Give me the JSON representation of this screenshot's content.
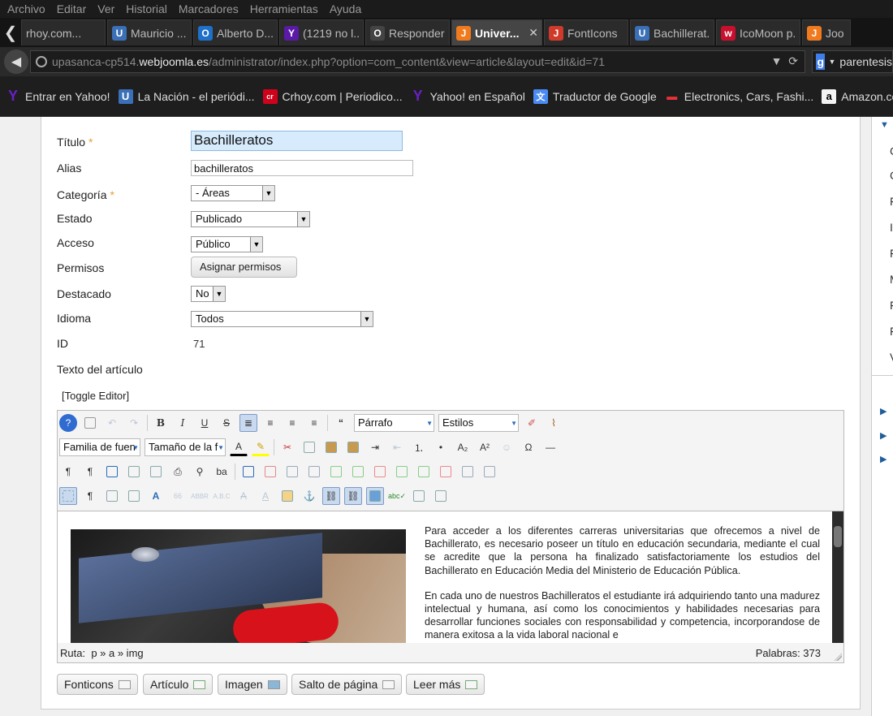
{
  "menu": [
    "Archivo",
    "Editar",
    "Ver",
    "Historial",
    "Marcadores",
    "Herramientas",
    "Ayuda"
  ],
  "tabs": [
    {
      "label": "rhoy.com...",
      "icon": "",
      "color": ""
    },
    {
      "label": "Mauricio ...",
      "icon": "U",
      "color": "#3b6fb6"
    },
    {
      "label": "Alberto D...",
      "icon": "O",
      "color": "#1e70c9"
    },
    {
      "label": "(1219 no l...",
      "icon": "Y",
      "color": "#5a1aa6"
    },
    {
      "label": "Responder...",
      "icon": "O",
      "color": "#444444"
    },
    {
      "label": "Univer...",
      "icon": "J",
      "color": "#f07a1e"
    },
    {
      "label": "FontIcons",
      "icon": "J",
      "color": "#d03a2a"
    },
    {
      "label": "Bachillerat...",
      "icon": "U",
      "color": "#3b6fb6"
    },
    {
      "label": "IcoMoon p...",
      "icon": "w",
      "color": "#c8102e"
    },
    {
      "label": "Joo",
      "icon": "J",
      "color": "#f07a1e"
    }
  ],
  "url": {
    "pre": "upasanca-cp514.",
    "host": "webjoomla.es",
    "post": "/administrator/index.php?option=com_content&view=article&layout=edit&id=71"
  },
  "search_text": "parentesis",
  "bookmarks": [
    {
      "label": "Entrar en Yahoo!",
      "icon": "Y",
      "color": "#6a1fc4",
      "bg": "transparent"
    },
    {
      "label": "La Nación - el periódi...",
      "icon": "U",
      "color": "#ffffff",
      "bg": "#3b6fb6"
    },
    {
      "label": "Crhoy.com | Periodico...",
      "icon": "cr",
      "color": "#ffffff",
      "bg": "#d0021b"
    },
    {
      "label": "Yahoo! en Español",
      "icon": "Y",
      "color": "#6a1fc4",
      "bg": "transparent"
    },
    {
      "label": "Traductor de Google",
      "icon": "文",
      "color": "#ffffff",
      "bg": "#4a8af4"
    },
    {
      "label": "Electronics, Cars, Fashi...",
      "icon": "▬",
      "color": "#e53238",
      "bg": "transparent"
    },
    {
      "label": "Amazon.co",
      "icon": "a",
      "color": "#000000",
      "bg": "#f3f3f3"
    }
  ],
  "form": {
    "titulo_label": "Título",
    "titulo_value": "Bachilleratos",
    "alias_label": "Alias",
    "alias_value": "bachilleratos",
    "categoria_label": "Categoría",
    "categoria_value": "- Áreas",
    "estado_label": "Estado",
    "estado_value": "Publicado",
    "acceso_label": "Acceso",
    "acceso_value": "Público",
    "permisos_label": "Permisos",
    "permisos_button": "Asignar permisos",
    "destacado_label": "Destacado",
    "destacado_value": "No",
    "idioma_label": "Idioma",
    "idioma_value": "Todos",
    "id_label": "ID",
    "id_value": "71",
    "texto_label": "Texto del artículo",
    "toggle_editor": "[Toggle Editor]",
    "required_mark": "*"
  },
  "editor": {
    "format_select": "Párrafo",
    "styles_select": "Estilos",
    "font_family_select": "Familia de fuen",
    "font_size_select": "Tamaño de la f",
    "paragraph1": "Para acceder a los diferentes carreras universitarias que ofrecemos a nivel de Bachillerato, es necesario poseer un título en educación secundaria, mediante el cual se acredite que la persona ha finalizado satisfactoriamente los estudios del Bachillerato en Educación Media del Ministerio de Educación Pública.",
    "paragraph2": "En cada uno de nuestros Bachilleratos el estudiante irá adquiriendo tanto una madurez intelectual y humana, así como los conocimientos y habilidades necesarias para desarrollar funciones sociales con responsabilidad y competencia, incorporandose de manera exitosa a la vida laboral nacional e",
    "path_label": "Ruta:",
    "path_value": "p » a » img",
    "words_label": "Palabras: 373"
  },
  "buttons": {
    "fonticons": "Fonticons",
    "articulo": "Artículo",
    "imagen": "Imagen",
    "salto": "Salto de página",
    "leer_mas": "Leer más"
  },
  "right_letters": [
    "C",
    "C",
    "F",
    "Ir",
    "F",
    "M",
    "F",
    "F",
    "V"
  ]
}
